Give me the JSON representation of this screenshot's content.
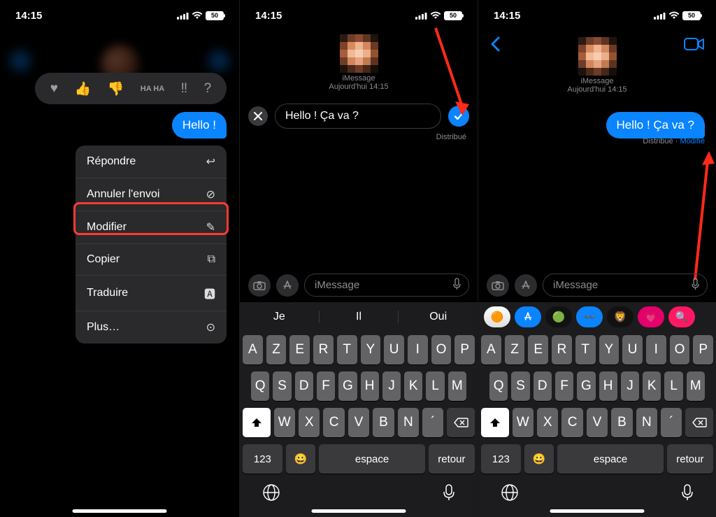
{
  "status": {
    "time": "14:15",
    "battery": "50"
  },
  "panel1": {
    "reactions": [
      "♥",
      "👍",
      "👎",
      "HA HA",
      "‼︎",
      "?"
    ],
    "bubble": "Hello !",
    "menu": [
      {
        "label": "Répondre",
        "icon": "↩︎"
      },
      {
        "label": "Annuler l'envoi",
        "icon": "⊘"
      },
      {
        "label": "Modifier",
        "icon": "✎"
      },
      {
        "label": "Copier",
        "icon": "⧉"
      },
      {
        "label": "Traduire",
        "icon": "🅰︎"
      },
      {
        "label": "Plus…",
        "icon": "⊙"
      }
    ]
  },
  "panel2": {
    "header1": "iMessage",
    "header2": "Aujourd'hui 14:15",
    "edit_value": "Hello ! Ça va ? ",
    "dist": "Distribué",
    "suggestions": [
      "Je",
      "Il",
      "Oui"
    ],
    "compose_placeholder": "iMessage"
  },
  "panel3": {
    "header1": "iMessage",
    "header2": "Aujourd'hui 14:15",
    "bubble": "Hello ! Ça va ?",
    "status_dist": "Distribué",
    "status_sep": " · ",
    "status_mod": "Modifié",
    "compose_placeholder": "iMessage"
  },
  "kbd": {
    "r1": [
      "A",
      "Z",
      "E",
      "R",
      "T",
      "Y",
      "U",
      "I",
      "O",
      "P"
    ],
    "r2": [
      "Q",
      "S",
      "D",
      "F",
      "G",
      "H",
      "J",
      "K",
      "L",
      "M"
    ],
    "r3_keys": [
      "W",
      "X",
      "C",
      "V",
      "B",
      "N",
      "´"
    ],
    "k123": "123",
    "space": "espace",
    "ret": "retour"
  }
}
